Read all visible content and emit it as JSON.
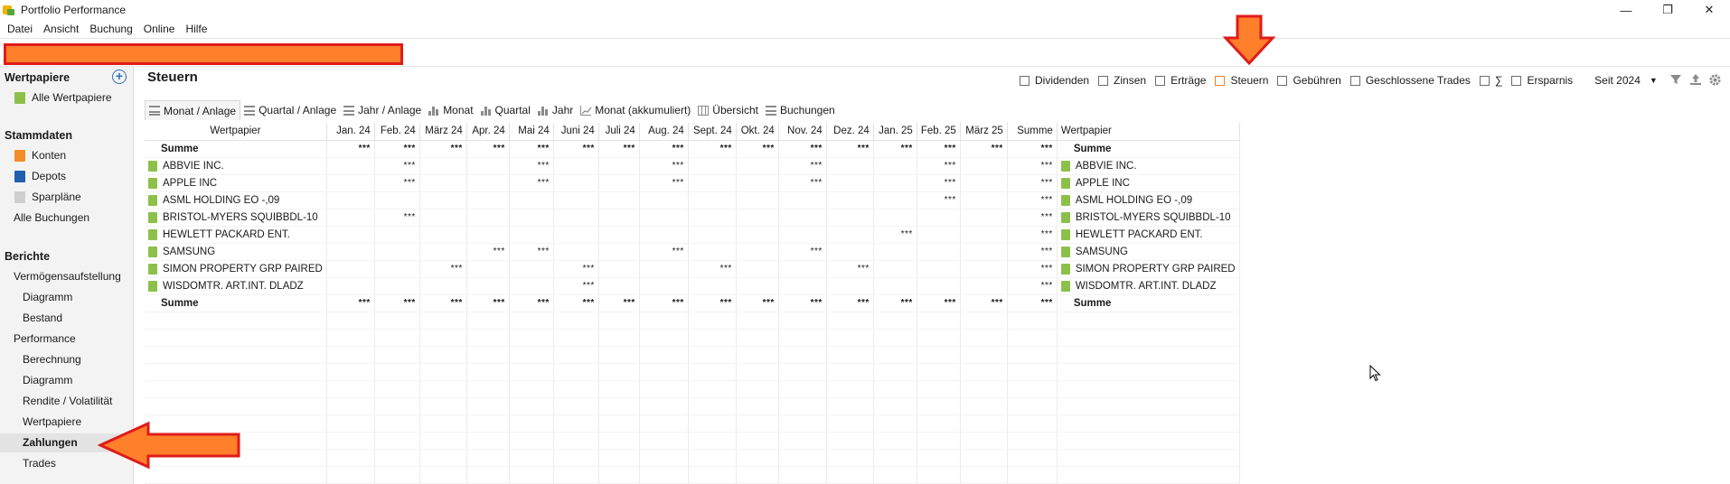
{
  "window": {
    "title": "Portfolio Performance",
    "controls": [
      "—",
      "❐",
      "✕"
    ]
  },
  "menu": [
    "Datei",
    "Ansicht",
    "Buchung",
    "Online",
    "Hilfe"
  ],
  "sidebar": {
    "sections": [
      {
        "title": "Wertpapiere",
        "items": [
          {
            "label": "Alle Wertpapiere",
            "icon": "green-security-icon"
          }
        ]
      },
      {
        "title": "Stammdaten",
        "items": [
          {
            "label": "Konten",
            "icon": "orange-account-icon"
          },
          {
            "label": "Depots",
            "icon": "blue-depot-icon"
          },
          {
            "label": "Sparpläne",
            "icon": "gray-plan-icon"
          },
          {
            "label": "Alle Buchungen",
            "icon": ""
          }
        ]
      },
      {
        "title": "Berichte",
        "items": [
          {
            "label": "Vermögensaufstellung"
          },
          {
            "label": "Diagramm"
          },
          {
            "label": "Bestand"
          },
          {
            "label": "Performance"
          },
          {
            "label": "Berechnung"
          },
          {
            "label": "Diagramm"
          },
          {
            "label": "Rendite / Volatilität"
          },
          {
            "label": "Wertpapiere"
          },
          {
            "label": "Zahlungen"
          },
          {
            "label": "Trades"
          }
        ]
      }
    ]
  },
  "main": {
    "title": "Steuern",
    "filters": [
      {
        "label": "Dividenden",
        "checked": false
      },
      {
        "label": "Zinsen",
        "checked": false
      },
      {
        "label": "Erträge",
        "checked": false
      },
      {
        "label": "Steuern",
        "checked": true
      },
      {
        "label": "Gebühren",
        "checked": false
      },
      {
        "label": "Geschlossene Trades",
        "checked": false
      },
      {
        "label": "∑",
        "checked": false
      },
      {
        "label": "Ersparnis",
        "checked": false
      }
    ],
    "period": "Seit 2024",
    "tabs": [
      "Monat / Anlage",
      "Quartal / Anlage",
      "Jahr / Anlage",
      "Monat",
      "Quartal",
      "Jahr",
      "Monat (akkumuliert)",
      "Übersicht",
      "Buchungen"
    ],
    "active_tab": 0
  },
  "table": {
    "name_header": "Wertpapier",
    "months": [
      "Jan. 24",
      "Feb. 24",
      "März 24",
      "Apr. 24",
      "Mai 24",
      "Juni 24",
      "Juli 24",
      "Aug. 24",
      "Sept. 24",
      "Okt. 24",
      "Nov. 24",
      "Dez. 24",
      "Jan. 25",
      "Feb. 25",
      "März 25"
    ],
    "sum_header": "Summe",
    "security_header": "Wertpapier",
    "masked": "***",
    "sum_label": "Summe",
    "rows": [
      {
        "name": "ABBVIE INC.",
        "cells": [
          0,
          1,
          0,
          0,
          1,
          0,
          0,
          1,
          0,
          0,
          1,
          0,
          0,
          1,
          0
        ]
      },
      {
        "name": "APPLE INC",
        "cells": [
          0,
          1,
          0,
          0,
          1,
          0,
          0,
          1,
          0,
          0,
          1,
          0,
          0,
          1,
          0
        ]
      },
      {
        "name": "ASML HOLDING EO -,09",
        "cells": [
          0,
          0,
          0,
          0,
          0,
          0,
          0,
          0,
          0,
          0,
          0,
          0,
          0,
          1,
          0
        ]
      },
      {
        "name": "BRISTOL-MYERS SQUIBBDL-10",
        "cells": [
          0,
          1,
          0,
          0,
          0,
          0,
          0,
          0,
          0,
          0,
          0,
          0,
          0,
          0,
          0
        ]
      },
      {
        "name": "HEWLETT PACKARD ENT.",
        "cells": [
          0,
          0,
          0,
          0,
          0,
          0,
          0,
          0,
          0,
          0,
          0,
          0,
          1,
          0,
          0
        ]
      },
      {
        "name": "SAMSUNG",
        "cells": [
          0,
          0,
          0,
          1,
          1,
          0,
          0,
          1,
          0,
          0,
          1,
          0,
          0,
          0,
          0
        ]
      },
      {
        "name": "SIMON PROPERTY GRP PAIRED",
        "cells": [
          0,
          0,
          1,
          0,
          0,
          1,
          0,
          0,
          1,
          0,
          0,
          1,
          0,
          0,
          0
        ]
      },
      {
        "name": "WISDOMTR. ART.INT. DLADZ",
        "cells": [
          0,
          0,
          0,
          0,
          0,
          1,
          0,
          0,
          0,
          0,
          0,
          0,
          0,
          0,
          0
        ]
      }
    ]
  }
}
